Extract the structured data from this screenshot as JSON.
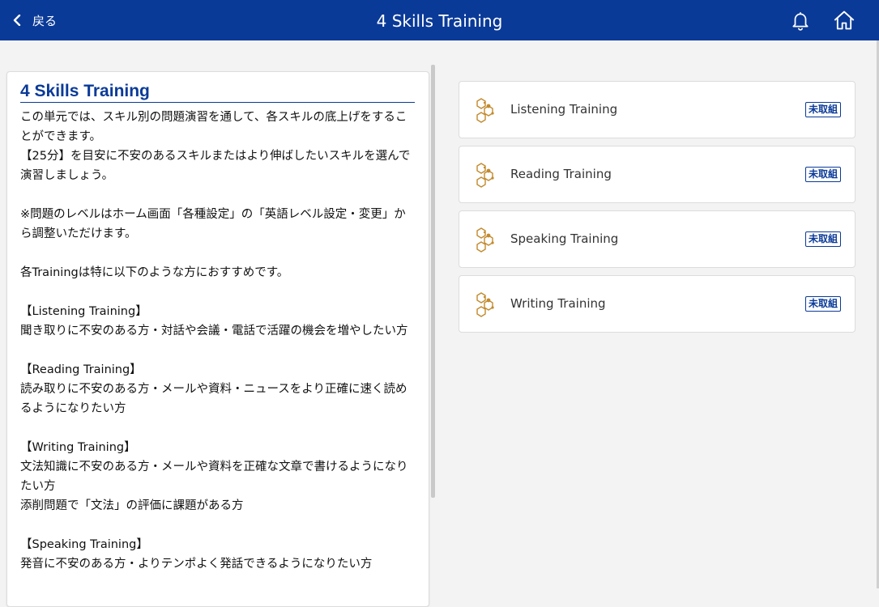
{
  "header": {
    "back_label": "戻る",
    "title": "4 Skills Training",
    "bar_color": "#0a3a98"
  },
  "intro": {
    "heading": "4 Skills Training",
    "paragraphs": [
      "この単元では、スキル別の問題演習を通して、各スキルの底上げをすることができます。",
      "【25分】を目安に不安のあるスキルまたはより伸ばしたいスキルを選んで演習しましょう。",
      "",
      "※問題のレベルはホーム画面「各種設定」の「英語レベル設定・変更」から調整いただけます。",
      "",
      "各Trainingは特に以下のような方におすすめです。",
      "",
      "【Listening Training】",
      "聞き取りに不安のある方・対話や会議・電話で活躍の機会を増やしたい方",
      "",
      "【Reading Training】",
      "読み取りに不安のある方・メールや資料・ニュースをより正確に速く読めるようになりたい方",
      "",
      "【Writing Training】",
      "文法知識に不安のある方・メールや資料を正確な文章で書けるようになりたい方",
      "添削問題で「文法」の評価に課題がある方",
      "",
      "【Speaking Training】",
      "発音に不安のある方・よりテンポよく発話できるようになりたい方"
    ]
  },
  "trainings": [
    {
      "label": "Listening Training",
      "status": "未取組",
      "icon": "hexagon-molecule-icon"
    },
    {
      "label": "Reading Training",
      "status": "未取組",
      "icon": "hexagon-molecule-icon"
    },
    {
      "label": "Speaking Training",
      "status": "未取組",
      "icon": "hexagon-molecule-icon"
    },
    {
      "label": "Writing Training",
      "status": "未取組",
      "icon": "hexagon-molecule-icon"
    }
  ],
  "icons": {
    "back": "chevron-left-icon",
    "notifications": "bell-icon",
    "home": "home-icon"
  },
  "colors": {
    "accent": "#0a3a98",
    "icon_gold": "#c28a2c"
  }
}
